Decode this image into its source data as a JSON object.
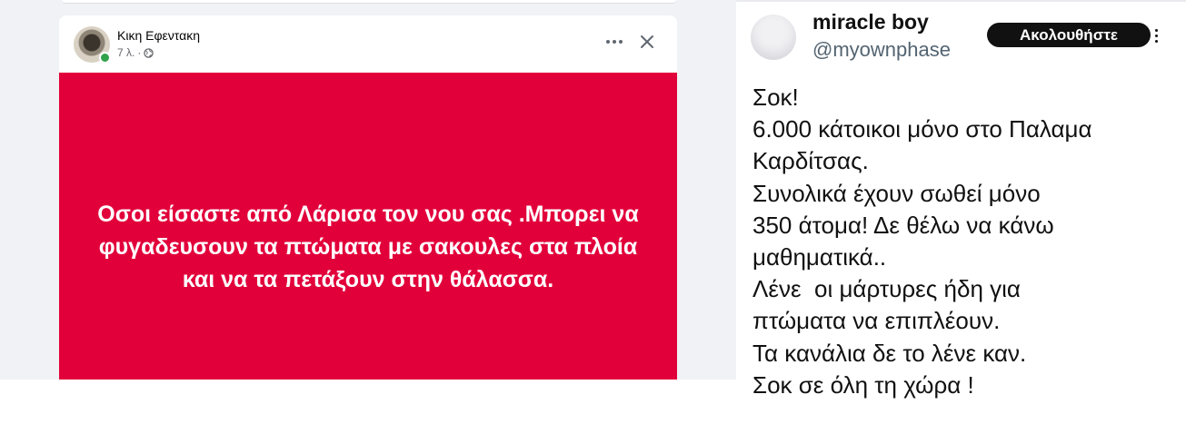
{
  "facebook_post": {
    "author_name": "Κικη Εφεντακη",
    "timestamp": "7 λ.",
    "audience_icon": "globe-icon",
    "post_text": "Οσοι είσαστε από Λάρισα τον νου σας .Μπορει να φυγαδευσουν τα πτώματα με σακουλες στα πλοία και να τα πετάξουν στην θάλασσα.",
    "post_background_color": "#e2003b"
  },
  "tweet": {
    "display_name": "miracle boy",
    "handle": "@myownphase",
    "follow_label": "Ακολουθήστε",
    "lines": [
      "Σοκ!",
      "6.000 κάτοικοι μόνο στο Παλαμα",
      "Καρδίτσας.",
      "Συνολικά έχουν σωθεί μόνο",
      "350 άτομα! Δε θέλω να κάνω",
      "μαθηματικά..",
      "Λένε  οι μάρτυρες ήδη για",
      "πτώματα να επιπλέουν.",
      "Τα κανάλια δε το λένε καν.",
      "Σοκ σε όλη τη χώρα !"
    ]
  }
}
